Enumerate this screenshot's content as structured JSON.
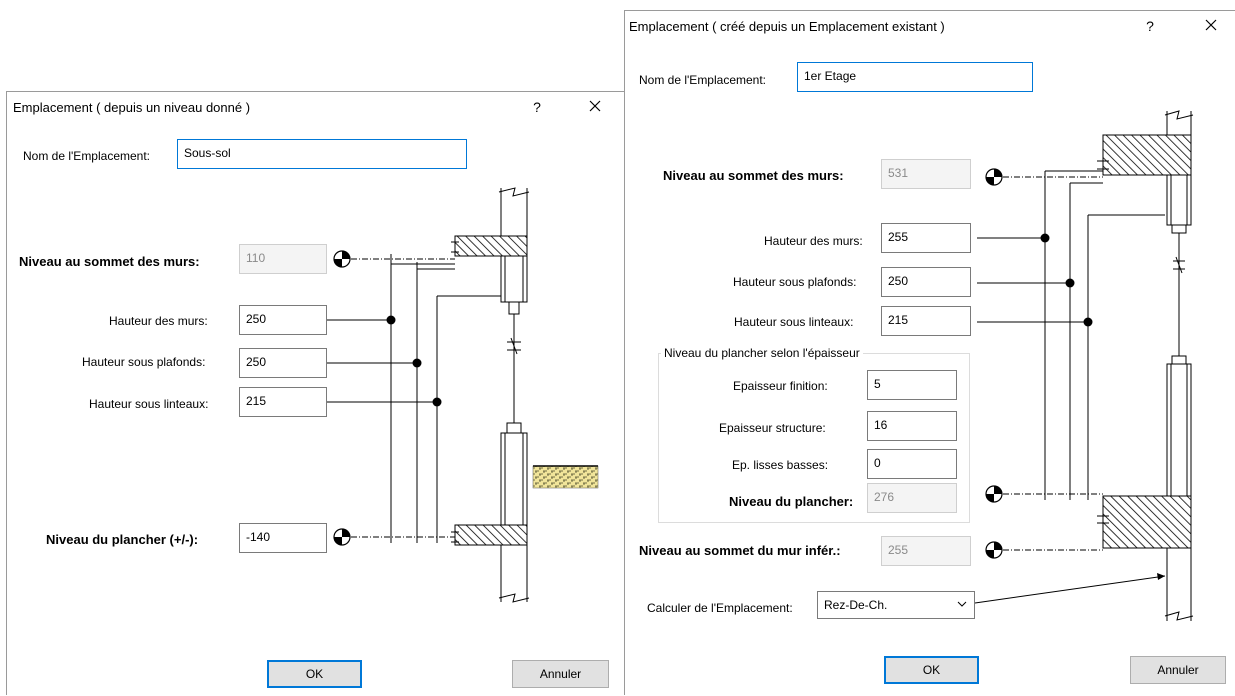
{
  "dialog1": {
    "title": "Emplacement ( depuis un niveau donné )",
    "help": "?",
    "name_label": "Nom de l'Emplacement:",
    "name_value": "Sous-sol",
    "top_label": "Niveau au sommet des murs:",
    "top_value": "110",
    "wall_height_label": "Hauteur des murs:",
    "wall_height_value": "250",
    "ceiling_label": "Hauteur sous plafonds:",
    "ceiling_value": "250",
    "lintel_label": "Hauteur sous linteaux:",
    "lintel_value": "215",
    "floor_label": "Niveau du plancher (+/-):",
    "floor_value": "-140",
    "ok": "OK",
    "cancel": "Annuler"
  },
  "dialog2": {
    "title": "Emplacement ( créé depuis un Emplacement existant )",
    "help": "?",
    "name_label": "Nom de l'Emplacement:",
    "name_value": "1er Etage",
    "top_label": "Niveau au sommet des murs:",
    "top_value": "531",
    "wall_height_label": "Hauteur des murs:",
    "wall_height_value": "255",
    "ceiling_label": "Hauteur sous plafonds:",
    "ceiling_value": "250",
    "lintel_label": "Hauteur sous linteaux:",
    "lintel_value": "215",
    "group_label": "Niveau du plancher selon l'épaisseur",
    "finish_label": "Epaisseur finition:",
    "finish_value": "5",
    "structure_label": "Epaisseur structure:",
    "structure_value": "16",
    "sill_label": "Ep. lisses basses:",
    "sill_value": "0",
    "floor_label": "Niveau du plancher:",
    "floor_value": "276",
    "lower_wall_label": "Niveau au sommet du mur infér.:",
    "lower_wall_value": "255",
    "calc_label": "Calculer de l'Emplacement:",
    "calc_value": "Rez-De-Ch.",
    "ok": "OK",
    "cancel": "Annuler"
  }
}
